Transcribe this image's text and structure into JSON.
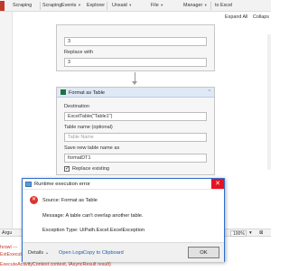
{
  "ribbon": {
    "items": [
      "Scraping",
      "Scraping",
      "Events",
      "Explorer",
      "Unsaid",
      "File",
      "Manager",
      "to Excel"
    ]
  },
  "canvas_toolbar": {
    "expand_all": "Expand All",
    "collapse": "Collaps"
  },
  "activity_top": {
    "field1_value": "3",
    "replace_label": "Replace with",
    "replace_value": "3"
  },
  "format_table": {
    "title": "Format as Table",
    "destination_label": "Destination",
    "destination_value": "ExcelTable(\"Table1\")",
    "table_name_label": "Table name (optional)",
    "table_name_placeholder": "Table Name",
    "save_new_label": "Save new table name as",
    "save_new_value": "formatDT1",
    "replace_existing_label": "Replace existing"
  },
  "status_bar": {
    "left_item": "Argu",
    "zoom_value": "100%"
  },
  "output": {
    "lines": [
      "hrowl ---",
      "ExtExecute",
      "ExecuteActivityContext context, IAsyncResult result)"
    ]
  },
  "dialog": {
    "title": "Runtime execution error",
    "source": "Source: Format as Table",
    "message": "Message: A table can't overlap another table.",
    "exception": "Exception Type: UiPath.Excel.ExcelException",
    "details": "Details",
    "open_logs": "Open Logs",
    "copy_clipboard": "Copy to Clipboard",
    "ok": "OK"
  },
  "colors": {
    "dialog_border": "#2c6fcc",
    "link": "#1f5faa",
    "error_red": "#d9342b",
    "excel_green": "#1e7145"
  }
}
